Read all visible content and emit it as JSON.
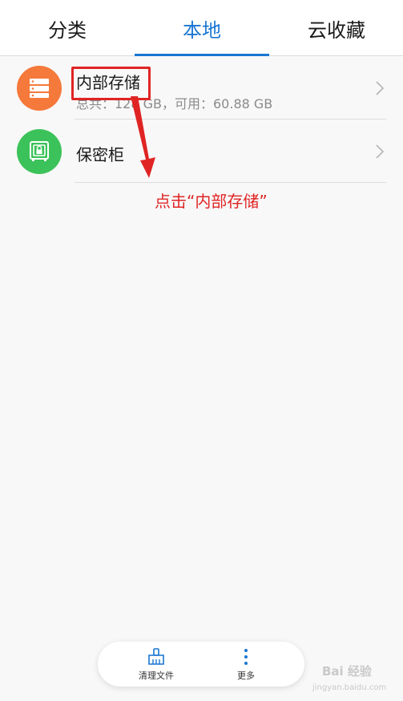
{
  "tabs": [
    {
      "label": "分类",
      "active": false
    },
    {
      "label": "本地",
      "active": true
    },
    {
      "label": "云收藏",
      "active": false
    }
  ],
  "colors": {
    "accent": "#1976d2",
    "storage_icon_bg": "#f5793b",
    "safe_icon_bg": "#3cc25a",
    "annotation": "#e02424"
  },
  "list": [
    {
      "title": "内部存储",
      "subtitle": "总共：128 GB，可用：60.88 GB",
      "icon": "storage-icon"
    },
    {
      "title": "保密柜",
      "subtitle": "",
      "icon": "safe-icon"
    }
  ],
  "annotation": {
    "text": "点击“内部存储”"
  },
  "bottom_bar": [
    {
      "label": "清理文件",
      "icon": "broom-icon"
    },
    {
      "label": "更多",
      "icon": "more-vertical-icon"
    }
  ],
  "watermark": {
    "main": "Bai 经验",
    "sub": "jingyan.baidu.com"
  }
}
